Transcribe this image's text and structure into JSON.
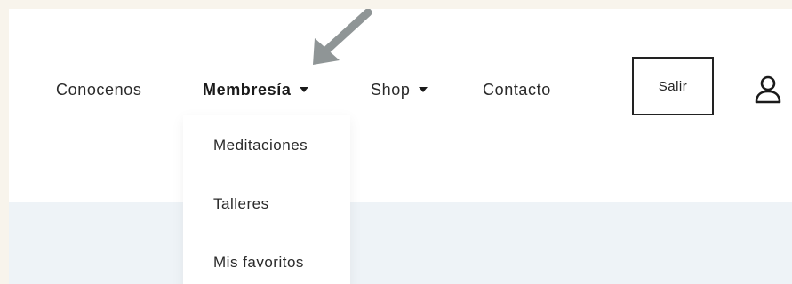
{
  "nav": {
    "items": [
      {
        "label": "Conocenos"
      },
      {
        "label": "Membresía"
      },
      {
        "label": "Shop"
      },
      {
        "label": "Contacto"
      }
    ],
    "logout_label": "Salir"
  },
  "dropdown": {
    "items": [
      {
        "label": "Meditaciones"
      },
      {
        "label": "Talleres"
      },
      {
        "label": "Mis favoritos"
      }
    ]
  },
  "colors": {
    "page_background": "#f8f4ec",
    "hero_background": "#eef3f7",
    "arrow": "#8f9596",
    "text": "#2a2a2a"
  },
  "icons": [
    "caret-down-icon",
    "user-icon",
    "pointer-arrow-icon"
  ]
}
